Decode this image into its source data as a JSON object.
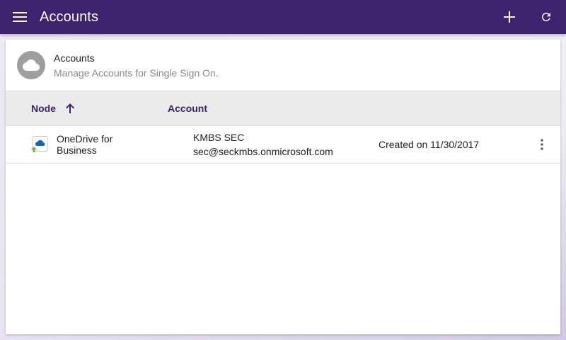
{
  "app": {
    "title": "Accounts",
    "colors": {
      "toolbar": "#3d2270",
      "accent": "#3d2270",
      "table_header_bg": "#ebebeb"
    }
  },
  "toolbar": {
    "menu_icon": "hamburger-menu-icon",
    "add_icon": "plus-icon",
    "refresh_icon": "refresh-icon"
  },
  "card": {
    "icon": "cloud-icon",
    "title": "Accounts",
    "subtitle": "Manage Accounts for Single Sign On."
  },
  "table": {
    "columns": {
      "node": "Node",
      "account": "Account"
    },
    "sort": {
      "column": "Node",
      "direction": "ascending",
      "icon": "arrow-up-icon"
    },
    "rows": [
      {
        "node_icon": "onedrive-icon",
        "node": "OneDrive for Business",
        "account_name": "KMBS SEC",
        "account_email": "sec@seckmbs.onmicrosoft.com",
        "created": "Created on 11/30/2017",
        "menu_icon": "more-vert-icon"
      }
    ]
  }
}
